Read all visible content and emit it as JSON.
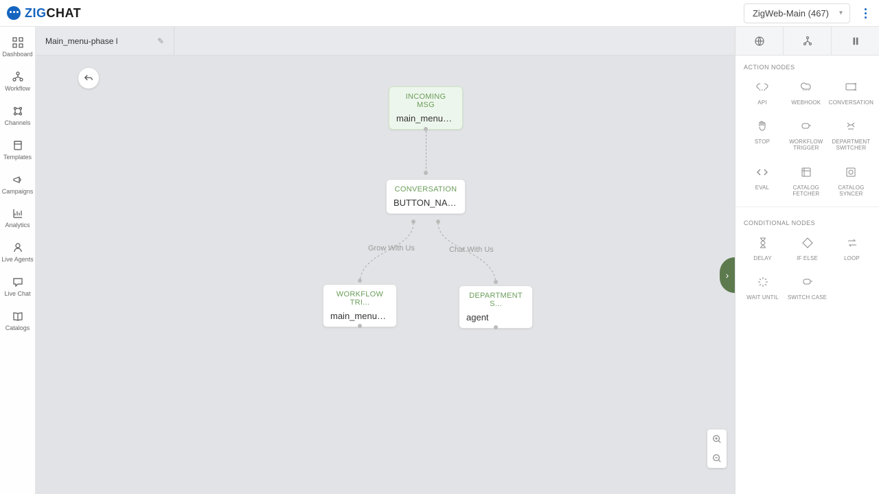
{
  "header": {
    "brand_first": "ZIG",
    "brand_second": "CHAT",
    "project": "ZigWeb-Main (467)"
  },
  "sidebar": {
    "items": [
      {
        "label": "Dashboard"
      },
      {
        "label": "Workflow"
      },
      {
        "label": "Channels"
      },
      {
        "label": "Templates"
      },
      {
        "label": "Campaigns"
      },
      {
        "label": "Analytics"
      },
      {
        "label": "Live Agents"
      },
      {
        "label": "Live Chat"
      },
      {
        "label": "Catalogs"
      }
    ]
  },
  "workflow": {
    "name": "Main_menu-phase l"
  },
  "nodes": {
    "incoming": {
      "type": "INCOMING MSG",
      "title": "main_menu_bu..."
    },
    "conversation": {
      "type": "CONVERSATION",
      "title": "BUTTON_NAME"
    },
    "trigger": {
      "type": "WORKFLOW TRI...",
      "title": "main_menu_op..."
    },
    "switcher": {
      "type": "DEPARTMENT S...",
      "title": "agent"
    },
    "branch_left": "Grow With Us",
    "branch_right": "Chat With Us"
  },
  "panel": {
    "action_title": "ACTION NODES",
    "conditional_title": "CONDITIONAL NODES",
    "action_nodes": [
      {
        "label": "API"
      },
      {
        "label": "WEBHOOK"
      },
      {
        "label": "CONVERSATION"
      },
      {
        "label": "STOP"
      },
      {
        "label": "WORKFLOW TRIGGER"
      },
      {
        "label": "DEPARTMENT SWITCHER"
      },
      {
        "label": "EVAL"
      },
      {
        "label": "CATALOG FETCHER"
      },
      {
        "label": "CATALOG SYNCER"
      }
    ],
    "conditional_nodes": [
      {
        "label": "DELAY"
      },
      {
        "label": "IF ELSE"
      },
      {
        "label": "LOOP"
      },
      {
        "label": "WAIT UNTIL"
      },
      {
        "label": "SWITCH CASE"
      }
    ]
  }
}
